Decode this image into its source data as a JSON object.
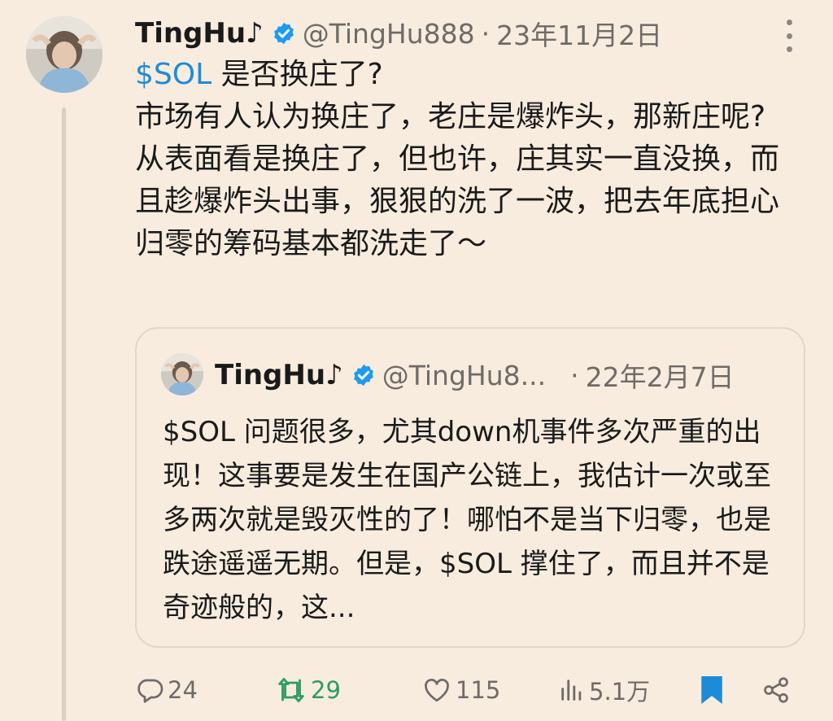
{
  "tweet": {
    "author": {
      "display_name": "TingHu♪",
      "handle": "@TingHu888",
      "date": "23年11月2日"
    },
    "text": {
      "cashtag": "$SOL",
      "line1_rest": " 是否换庄了?",
      "line2": "市场有人认为换庄了，老庄是爆炸头，那新庄呢?",
      "line3": "从表面看是换庄了，但也许，庄其实一直没换，而且趁爆炸头出事，狠狠的洗了一波，把去年底担心归零的筹码基本都洗走了～"
    }
  },
  "quoted_tweet": {
    "author": {
      "display_name": "TingHu♪",
      "handle": "@TingHu8...",
      "date": "22年2月7日"
    },
    "text": "$SOL 问题很多，尤其down机事件多次严重的出现！这事要是发生在国产公链上，我估计一次或至多两次就是毁灭性的了！哪怕不是当下归零，也是跌途遥遥无期。但是，$SOL 撑住了，而且并不是奇迹般的，这..."
  },
  "actions": {
    "replies": "24",
    "retweets": "29",
    "likes": "115",
    "views": "5.1万"
  },
  "colors": {
    "background": "#f8ecdf",
    "link": "#1d8cd8",
    "verified": "#1d9bf0",
    "retweet": "#2f9b65",
    "bookmark": "#1d8cd8",
    "muted": "#6f6b67"
  },
  "icons": [
    "avatar",
    "verified-badge-icon",
    "more-icon",
    "reply-icon",
    "retweet-icon",
    "like-icon",
    "views-icon",
    "bookmark-icon",
    "share-icon"
  ]
}
